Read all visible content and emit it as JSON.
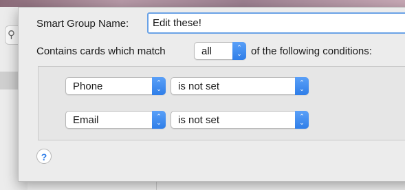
{
  "sheet": {
    "name_label": "Smart Group Name:",
    "name_value": "Edit these!",
    "match_prefix": "Contains cards which match",
    "match_value": "all",
    "match_suffix": "of the following conditions:",
    "conditions": [
      {
        "field": "Phone",
        "operator": "is not set"
      },
      {
        "field": "Email",
        "operator": "is not set"
      }
    ],
    "help_label": "?"
  },
  "icons": {
    "search": "search-icon",
    "stepper": "up-down-chevron-icon"
  },
  "colors": {
    "accent": "#2f7ee8",
    "focus_ring": "#6aa2e6"
  }
}
